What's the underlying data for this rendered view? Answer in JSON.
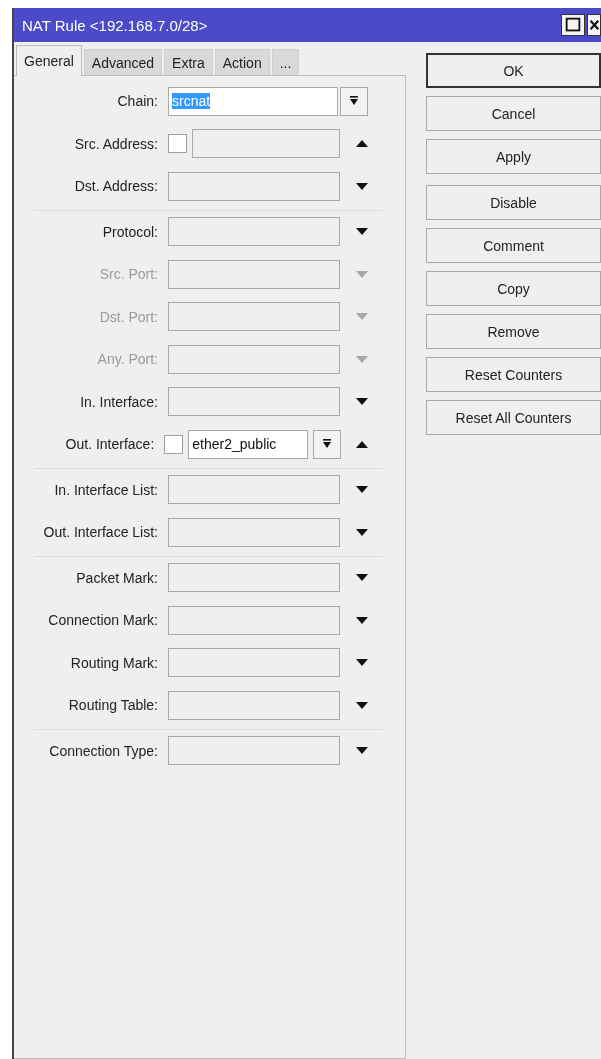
{
  "window": {
    "title": "NAT Rule <192.168.7.0/28>"
  },
  "tabs": [
    {
      "label": "General",
      "selected": true
    },
    {
      "label": "Advanced",
      "selected": false
    },
    {
      "label": "Extra",
      "selected": false
    },
    {
      "label": "Action",
      "selected": false
    },
    {
      "label": "...",
      "selected": false
    }
  ],
  "sections": [
    {
      "rows": [
        {
          "kind": "select",
          "label": "Chain:",
          "value": "srcnat",
          "value_highlighted": true,
          "disabled": false
        },
        {
          "kind": "negatable",
          "label": "Src. Address:",
          "negated": false,
          "expanded": true,
          "disabled": false
        },
        {
          "kind": "combo",
          "label": "Dst. Address:",
          "expanded": false,
          "disabled": false
        }
      ]
    },
    {
      "rows": [
        {
          "kind": "combo",
          "label": "Protocol:",
          "expanded": false,
          "disabled": false
        },
        {
          "kind": "combo",
          "label": "Src. Port:",
          "expanded": false,
          "disabled": true
        },
        {
          "kind": "combo",
          "label": "Dst. Port:",
          "expanded": false,
          "disabled": true
        },
        {
          "kind": "combo",
          "label": "Any. Port:",
          "expanded": false,
          "disabled": true
        },
        {
          "kind": "combo",
          "label": "In. Interface:",
          "expanded": false,
          "disabled": false
        },
        {
          "kind": "negatable-list",
          "label": "Out. Interface:",
          "negated": false,
          "value": "ether2_public",
          "value_highlighted": false,
          "expanded": true,
          "disabled": false
        }
      ]
    },
    {
      "rows": [
        {
          "kind": "combo",
          "label": "In. Interface List:",
          "expanded": false,
          "disabled": false
        },
        {
          "kind": "combo",
          "label": "Out. Interface List:",
          "expanded": false,
          "disabled": false
        }
      ]
    },
    {
      "rows": [
        {
          "kind": "combo",
          "label": "Packet Mark:",
          "expanded": false,
          "disabled": false
        },
        {
          "kind": "combo",
          "label": "Connection Mark:",
          "expanded": false,
          "disabled": false
        },
        {
          "kind": "combo",
          "label": "Routing Mark:",
          "expanded": false,
          "disabled": false
        },
        {
          "kind": "combo",
          "label": "Routing Table:",
          "expanded": false,
          "disabled": false
        }
      ]
    },
    {
      "rows": [
        {
          "kind": "combo",
          "label": "Connection Type:",
          "expanded": false,
          "disabled": false
        }
      ]
    }
  ],
  "button_groups": [
    [
      {
        "label": "OK",
        "default": true
      },
      {
        "label": "Cancel",
        "default": false
      },
      {
        "label": "Apply",
        "default": false
      }
    ],
    [
      {
        "label": "Disable",
        "default": false
      },
      {
        "label": "Comment",
        "default": false
      },
      {
        "label": "Copy",
        "default": false
      },
      {
        "label": "Remove",
        "default": false
      },
      {
        "label": "Reset Counters",
        "default": false
      },
      {
        "label": "Reset All Counters",
        "default": false
      }
    ]
  ]
}
